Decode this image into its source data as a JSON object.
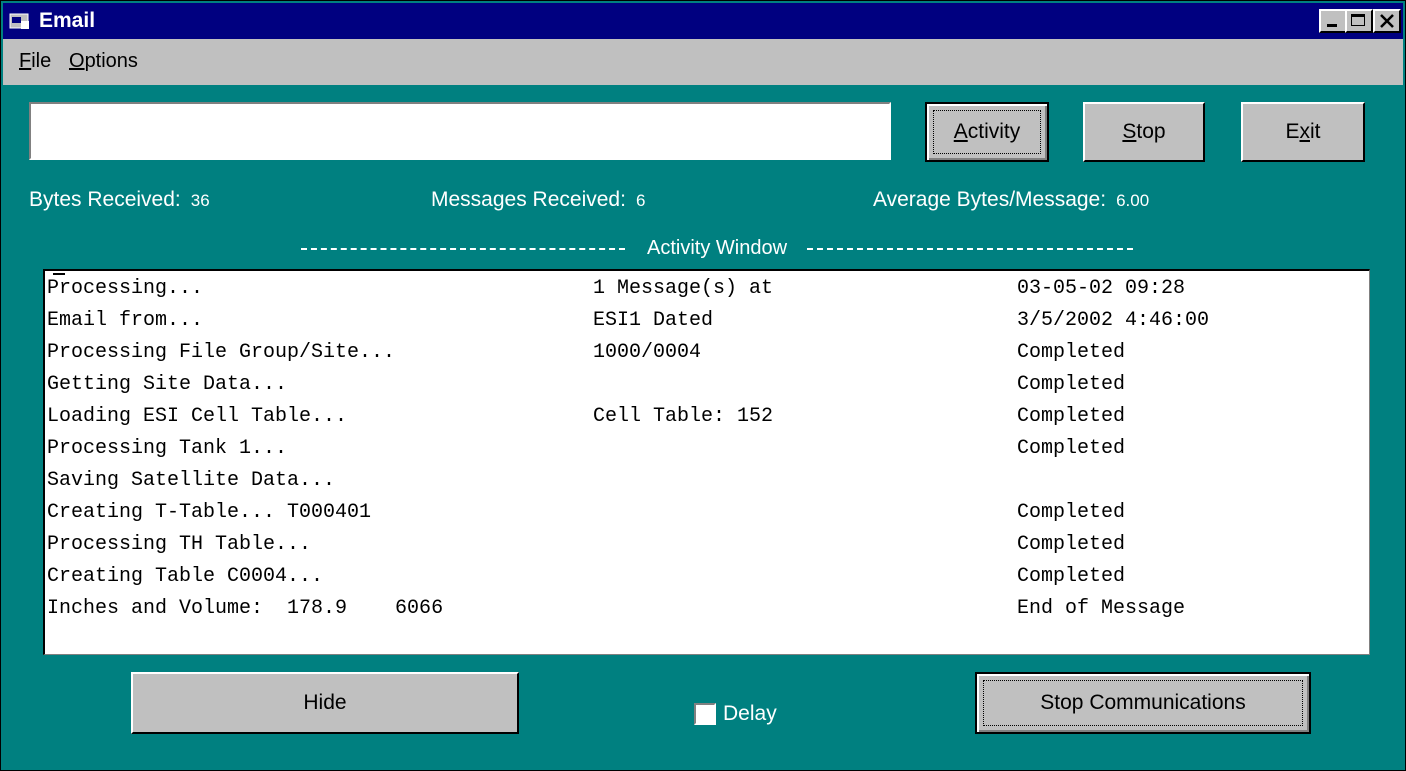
{
  "window": {
    "title": "Email"
  },
  "menu": [
    {
      "label": "File",
      "accel": "F",
      "rest": "ile"
    },
    {
      "label": "Options",
      "accel": "O",
      "rest": "ptions"
    }
  ],
  "input": {
    "value": ""
  },
  "buttons": {
    "activity": {
      "accel": "A",
      "rest": "ctivity"
    },
    "stop": {
      "accel": "S",
      "rest": "top"
    },
    "exit": {
      "pre": "E",
      "accel": "x",
      "rest": "it"
    },
    "hide": "Hide",
    "stop_comms": "Stop Communications"
  },
  "stats": {
    "bytes_label": "Bytes Received:",
    "bytes_value": "36",
    "messages_label": "Messages Received:",
    "messages_value": "6",
    "avg_label": "Average Bytes/Message:",
    "avg_value": "6.00"
  },
  "activity": {
    "title": "Activity Window",
    "rows": [
      [
        "Processing...",
        "1 Message(s) at",
        "03-05-02 09:28"
      ],
      [
        "Email from...",
        "ESI1 Dated",
        "3/5/2002 4:46:00"
      ],
      [
        "Processing File Group/Site...",
        "1000/0004",
        "Completed"
      ],
      [
        "Getting Site Data...",
        "",
        "Completed"
      ],
      [
        "Loading ESI Cell Table...",
        "Cell Table: 152",
        "Completed"
      ],
      [
        "Processing Tank 1...",
        "",
        "Completed"
      ],
      [
        "Saving Satellite Data...",
        "",
        ""
      ],
      [
        "Creating T-Table... T000401",
        "",
        "Completed"
      ],
      [
        "Processing TH Table...",
        "",
        "Completed"
      ],
      [
        "Creating Table C0004...",
        "",
        "Completed"
      ],
      [
        "Inches and Volume:  178.9    6066",
        "",
        "End of Message"
      ]
    ]
  },
  "delay": {
    "label": "Delay",
    "checked": false
  }
}
